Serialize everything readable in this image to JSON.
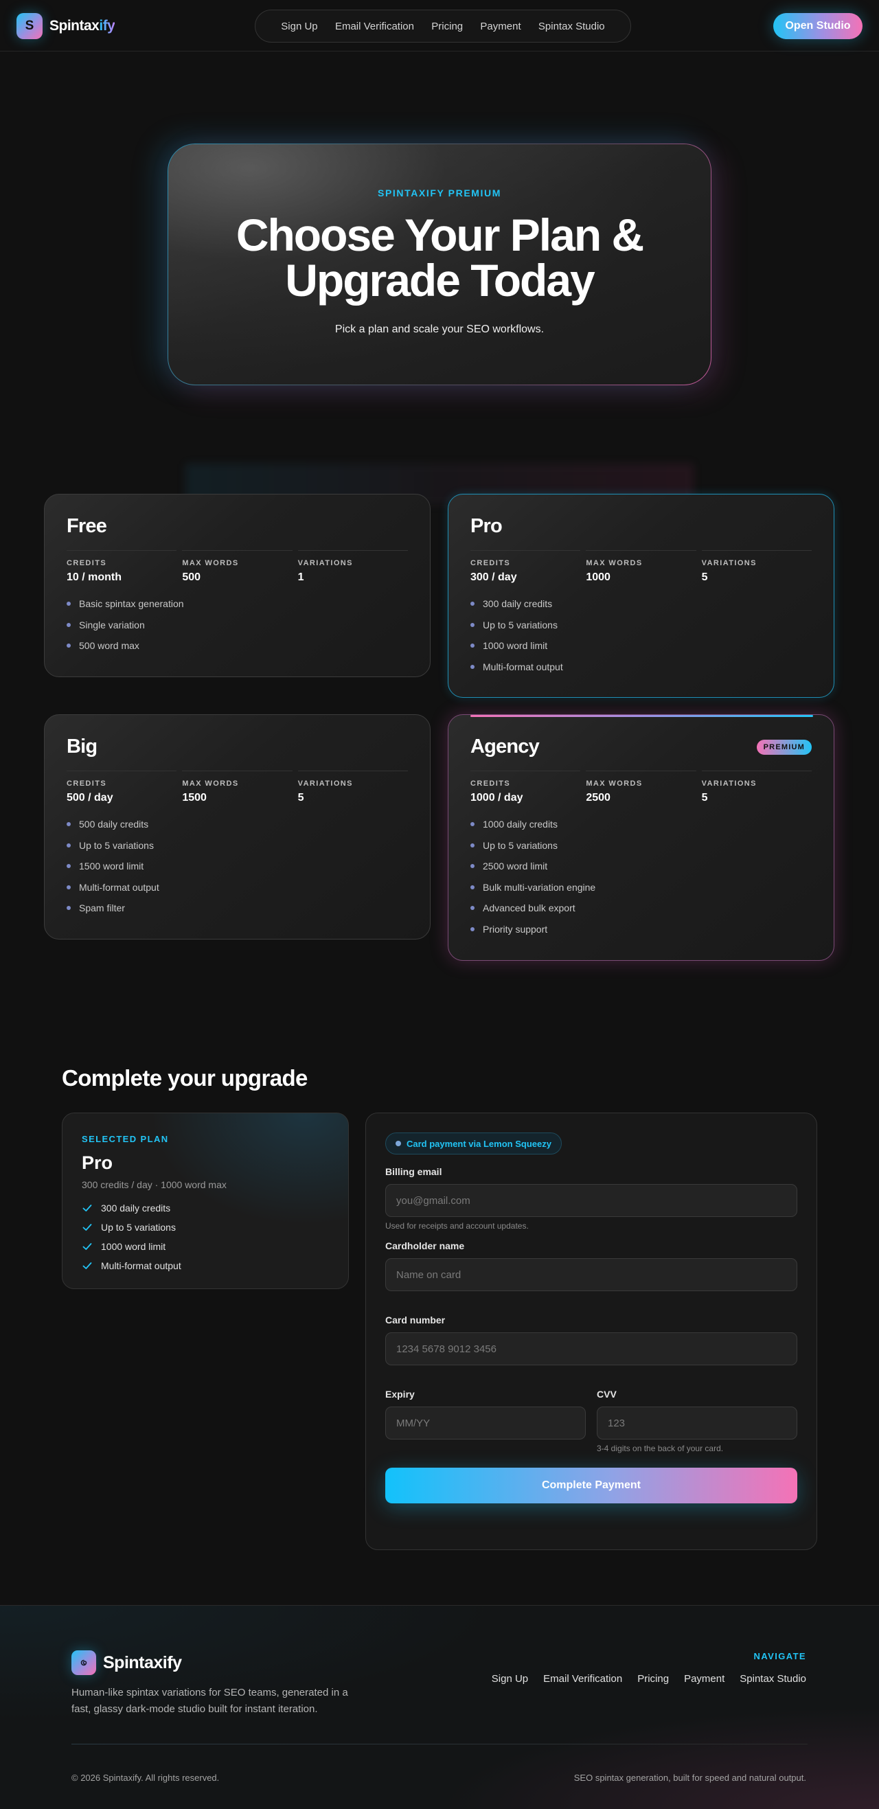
{
  "nav": {
    "logo_letter": "S",
    "logo_text_main": "Spintax",
    "logo_text_accent": "ify",
    "links": [
      "Sign Up",
      "Email Verification",
      "Pricing",
      "Payment",
      "Spintax Studio"
    ],
    "cta_label": "Open Studio"
  },
  "hero": {
    "kicker": "SPINTAXIFY PREMIUM",
    "title": "Choose Your Plan & Upgrade Today",
    "subtitle": "Pick a plan and scale your SEO workflows."
  },
  "plans": [
    {
      "name": "Free",
      "stats": [
        {
          "label": "CREDITS",
          "value": "10 / month"
        },
        {
          "label": "MAX WORDS",
          "value": "500"
        },
        {
          "label": "VARIATIONS",
          "value": "1"
        }
      ],
      "features": [
        "Basic spintax generation",
        "Single variation",
        "500 word max"
      ]
    },
    {
      "name": "Pro",
      "stats": [
        {
          "label": "CREDITS",
          "value": "300 / day"
        },
        {
          "label": "MAX WORDS",
          "value": "1000"
        },
        {
          "label": "VARIATIONS",
          "value": "5"
        }
      ],
      "features": [
        "300 daily credits",
        "Up to 5 variations",
        "1000 word limit",
        "Multi-format output"
      ]
    },
    {
      "name": "Big",
      "stats": [
        {
          "label": "CREDITS",
          "value": "500 / day"
        },
        {
          "label": "MAX WORDS",
          "value": "1500"
        },
        {
          "label": "VARIATIONS",
          "value": "5"
        }
      ],
      "features": [
        "500 daily credits",
        "Up to 5 variations",
        "1500 word limit",
        "Multi-format output",
        "Spam filter"
      ]
    },
    {
      "name": "Agency",
      "badge": "PREMIUM",
      "stats": [
        {
          "label": "CREDITS",
          "value": "1000 / day"
        },
        {
          "label": "MAX WORDS",
          "value": "2500"
        },
        {
          "label": "VARIATIONS",
          "value": "5"
        }
      ],
      "features": [
        "1000 daily credits",
        "Up to 5 variations",
        "2500 word limit",
        "Bulk multi-variation engine",
        "Advanced bulk export",
        "Priority support"
      ]
    }
  ],
  "checkout": {
    "title": "Complete your upgrade",
    "summary": {
      "kicker": "SELECTED PLAN",
      "plan_name": "Pro",
      "description": "300 credits / day · 1000 word max",
      "checks": [
        "300 daily credits",
        "Up to 5 variations",
        "1000 word limit",
        "Multi-format output"
      ]
    },
    "form": {
      "pill": "Card payment via Lemon Squeezy",
      "email_label": "Billing email",
      "email_placeholder": "you@gmail.com",
      "email_help": "Used for receipts and account updates.",
      "name_label": "Cardholder name",
      "name_placeholder": "Name on card",
      "card_label": "Card number",
      "card_placeholder": "1234 5678 9012 3456",
      "expiry_label": "Expiry",
      "expiry_placeholder": "MM/YY",
      "cvv_label": "CVV",
      "cvv_placeholder": "123",
      "cvv_help": "3-4 digits on the back of your card.",
      "submit_label": "Complete Payment"
    }
  },
  "footer": {
    "logo_letter": "S",
    "brand": "Spintaxify",
    "description": "Human-like spintax variations for SEO teams, generated in a fast, glassy dark-mode studio built for instant iteration.",
    "nav_title": "NAVIGATE",
    "links": [
      "Sign Up",
      "Email Verification",
      "Pricing",
      "Payment",
      "Spintax Studio"
    ],
    "copyright": "© 2026 Spintaxify. All rights reserved.",
    "tagline": "SEO spintax generation, built for speed and natural output."
  },
  "colors": {
    "accent_cyan": "#22c4f5",
    "accent_pink": "#f472b6",
    "background": "#111111"
  }
}
